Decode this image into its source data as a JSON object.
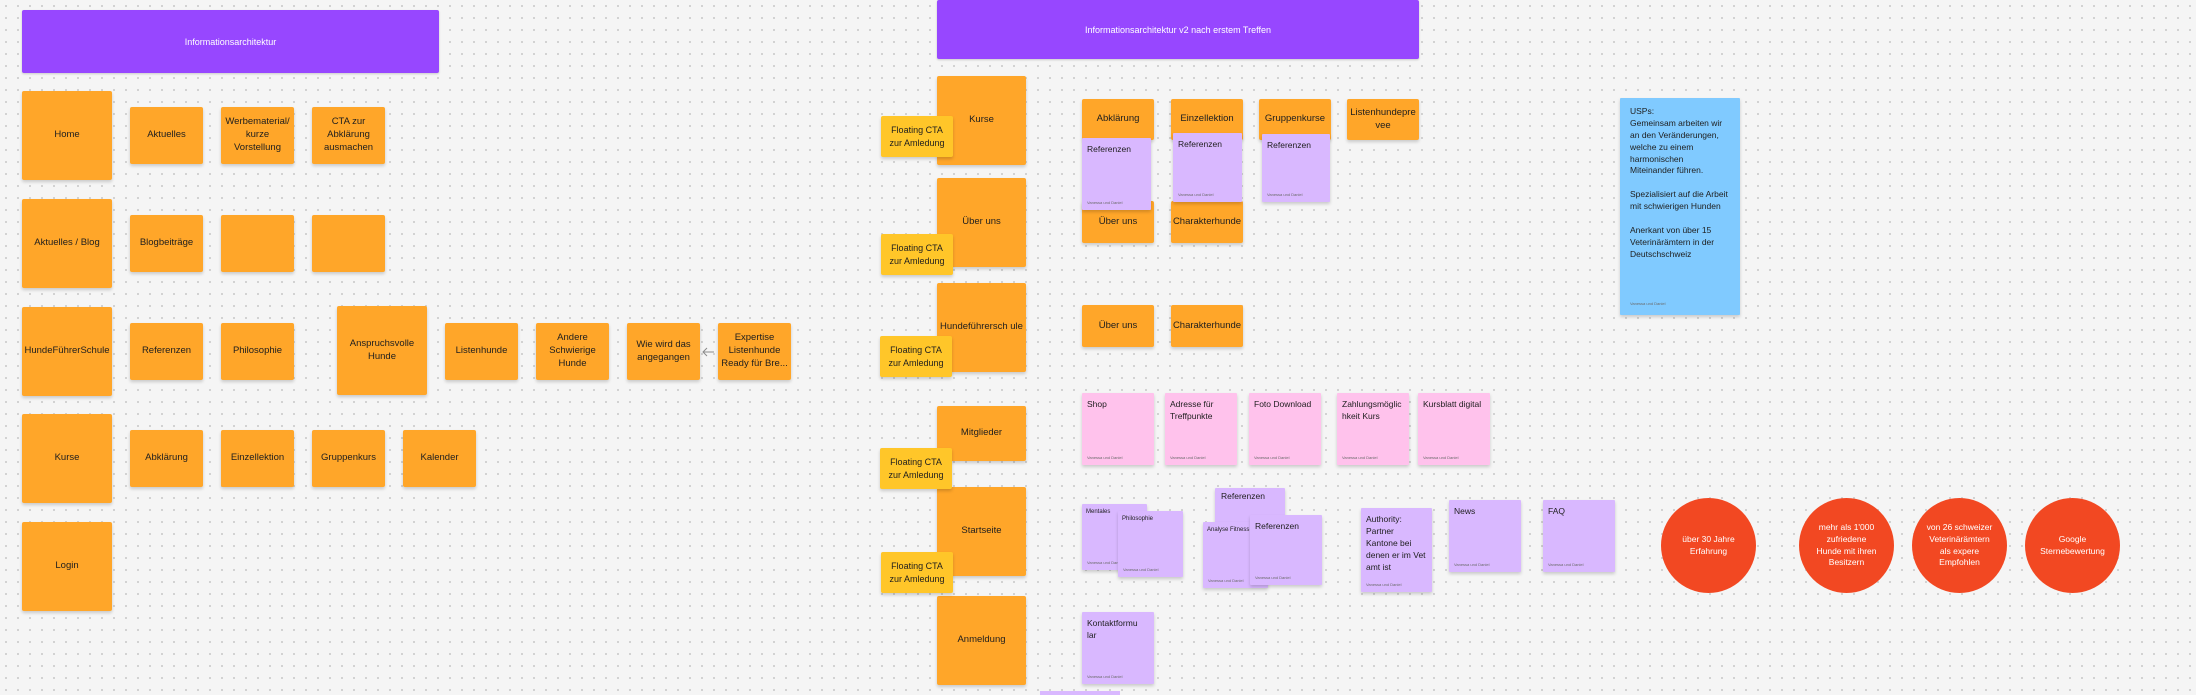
{
  "frames": {
    "left": "Informationsarchitektur",
    "right": "Informationsarchitektur v2 nach erstem Treffen"
  },
  "v1": {
    "home": "Home",
    "aktuelles": "Aktuelles",
    "werbematerial": "Werbematerial/ kurze Vorstellung",
    "cta_abklaerung": "CTA zur Abklärung ausmachen",
    "aktuelles_blog": "Aktuelles / Blog",
    "blogbeitraege": "Blogbeiträge",
    "blank1": "",
    "blank2": "",
    "hundefuehrerschule": "HundeFührerSchule",
    "referenzen": "Referenzen",
    "philosophie": "Philosophie",
    "anspruchsvolle": "Anspruchsvolle Hunde",
    "listenhunde": "Listenhunde",
    "andere": "Andere Schwierige Hunde",
    "wie_wird": "Wie wird das angegangen",
    "expertise": "Expertise Listenhunde Ready für Bre...",
    "kurse": "Kurse",
    "abklaerung": "Abklärung",
    "einzellektion": "Einzellektion",
    "gruppenkurs": "Gruppenkurs",
    "kalender": "Kalender",
    "login": "Login"
  },
  "v2": {
    "nav": {
      "kurse": "Kurse",
      "ueber_uns": "Über uns",
      "hundefuehrerschule": "Hundeführersch ule",
      "mitglieder": "Mitglieder",
      "startseite": "Startseite",
      "anmeldung": "Anmeldung"
    },
    "cta": "Floating CTA zur Amledung",
    "kurse_row": {
      "abklaerung": "Abklärung",
      "einzellektion": "Einzellektion",
      "gruppenkurse": "Gruppenkurse",
      "listenhunde": "Listenhundepre vee"
    },
    "referenzen": "Referenzen",
    "ueber_uns": "Über uns",
    "charakterhunde": "Charakterhunde",
    "author": "Vanessa und Daniel",
    "mitglieder_notes": {
      "shop": "Shop",
      "adresse": "Adresse für Treffpunkte",
      "foto": "Foto Download",
      "zahlung": "Zahlungsmöglic hkeit Kurs",
      "kursblatt": "Kursblatt digital"
    },
    "startseite_notes": {
      "mentales": "Mentales",
      "philosophie": "Philosophie",
      "referenzen": "Referenzen",
      "analyse": "Analyse Fitness",
      "referenzen2": "Referenzen",
      "authority": "Authority:\nPartner Kantone bei denen er im Vet amt ist",
      "news": "News",
      "faq": "FAQ"
    },
    "kontakt": "Kontaktformu lar",
    "usps": "USPs:\nGemeinsam arbeiten wir an den Veränderungen, welche zu einem harmonischen Miteinander führen.\n\nSpezialisiert auf die Arbeit mit schwierigen Hunden\n\nAnerkant von über 15 Veterinärämtern in der Deutschschweiz",
    "circles": {
      "c1": "über 30 Jahre Erfahrung",
      "c2": "mehr als 1'000 zufriedene Hunde mit ihren Besitzern",
      "c3": "von 26 schweizer Veterinärämtern als expere Empfohlen",
      "c4": "Google Sternebewertung"
    }
  },
  "colors": {
    "frame": "#9747ff",
    "orange": "#ffa629",
    "yellow": "#ffc629",
    "lilac": "#d9b8ff",
    "pink": "#ffc2ec",
    "blue": "#80caff",
    "red": "#f24822"
  }
}
